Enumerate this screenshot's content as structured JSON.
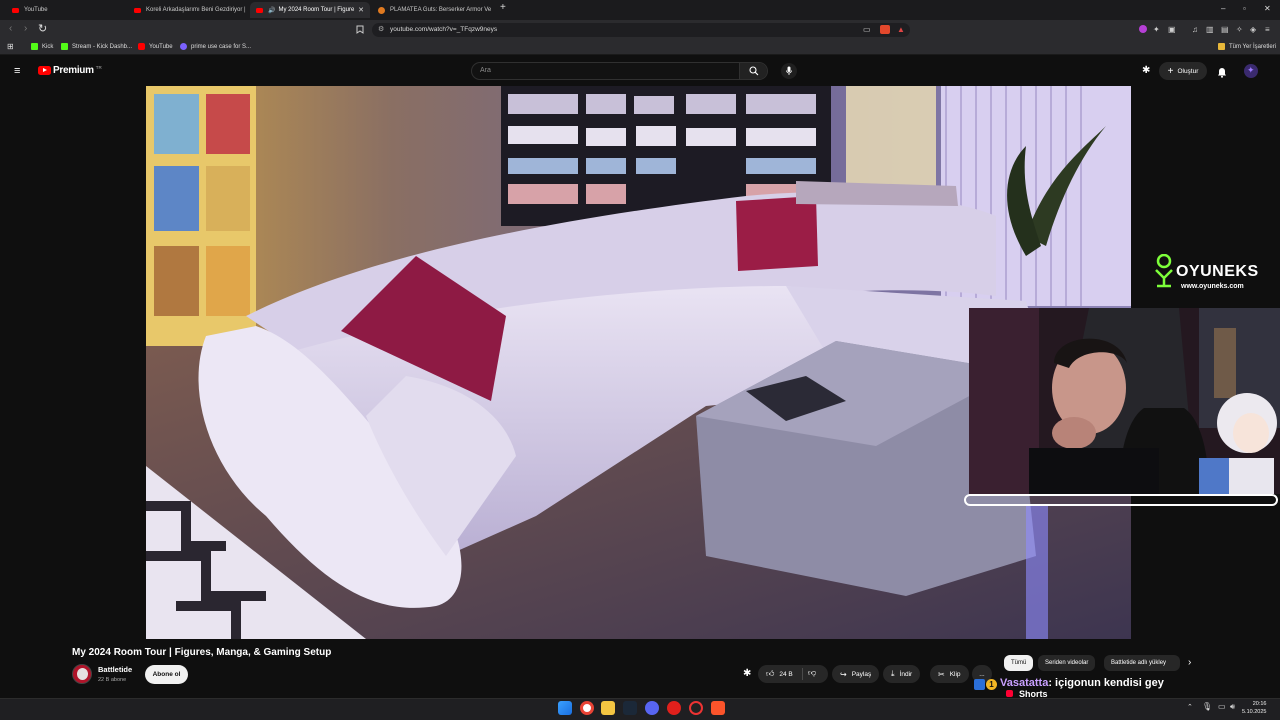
{
  "browser": {
    "tabs": [
      {
        "label": "YouTube",
        "active": false
      },
      {
        "label": "Koreli Arkadaşlarımı Beni Gezdiriyor | ",
        "active": false
      },
      {
        "label": "My 2024 Room Tour | Figure",
        "active": true
      },
      {
        "label": "PLAMATEA Guts: Berserker Armor Ve",
        "active": false
      }
    ],
    "new_tab": "+",
    "window_controls": [
      "–",
      "▫",
      "✕"
    ],
    "url": "youtube.com/watch?v=_TFqzw9neys",
    "bookmarks": [
      {
        "label": "Kick",
        "color": "#53fc18"
      },
      {
        "label": "Stream - Kick Dashb...",
        "color": "#53fc18"
      },
      {
        "label": "YouTube",
        "color": "#ff0000"
      },
      {
        "label": "prime use case for S...",
        "color": "#7b61ff"
      }
    ],
    "all_bookmarks": "Tüm Yer İşaretleri"
  },
  "youtube": {
    "logo_text": "Premium",
    "logo_superscript": "TR",
    "search_placeholder": "Ara",
    "create_label": "Oluştur",
    "video_title": "My 2024 Room Tour | Figures, Manga, & Gaming Setup",
    "channel_name": "Battletide",
    "channel_subs": "22 B abone",
    "subscribe_label": "Abone ol",
    "like_count": "24 B",
    "share_label": "Paylaş",
    "download_label": "İndir",
    "clip_label": "Klip",
    "more_label": "...",
    "chips": [
      "Tümü",
      "Seriden videolar",
      "Battletide adlı yükley"
    ],
    "accent": "#ff0000"
  },
  "overlay": {
    "brand_name": "OYUNEKS",
    "brand_url": "www.oyuneks.com",
    "chat_badge": "1",
    "chat_user": "Vasatatta",
    "chat_message": ": içigonun kendisi gey",
    "shorts_label": "Shorts"
  },
  "taskbar": {
    "time": "20:16",
    "date": "5.10.2025"
  }
}
